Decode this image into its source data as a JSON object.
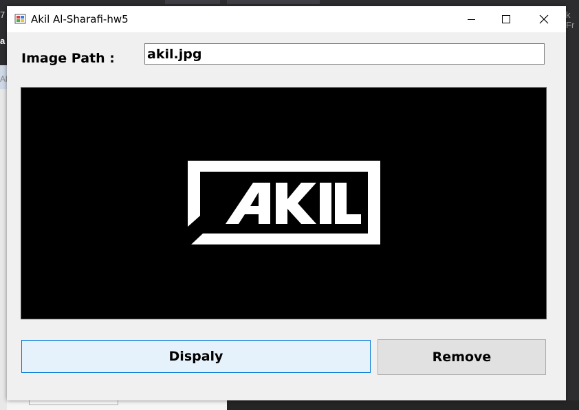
{
  "background": {
    "fragment_left": "7",
    "fragment_left_mid": "a",
    "fragment_left_low": "Al",
    "fragment_right": "k Fr"
  },
  "window": {
    "title": "Akil Al-Sharafi-hw5",
    "controls": {
      "minimize_icon": "minimize-icon",
      "maximize_icon": "maximize-icon",
      "close_icon": "close-icon"
    }
  },
  "form": {
    "path_label": "Image Path :",
    "path_value": "akil.jpg",
    "picture": {
      "logo_text": "AKIL",
      "background_color": "#000000",
      "foreground_color": "#ffffff"
    },
    "buttons": {
      "display_label": "Dispaly",
      "remove_label": "Remove"
    }
  },
  "colors": {
    "accent": "#0078d7",
    "display_button_bg": "#e5f1fb",
    "remove_button_bg": "#e1e1e1",
    "window_bg": "#f0f0f0"
  }
}
